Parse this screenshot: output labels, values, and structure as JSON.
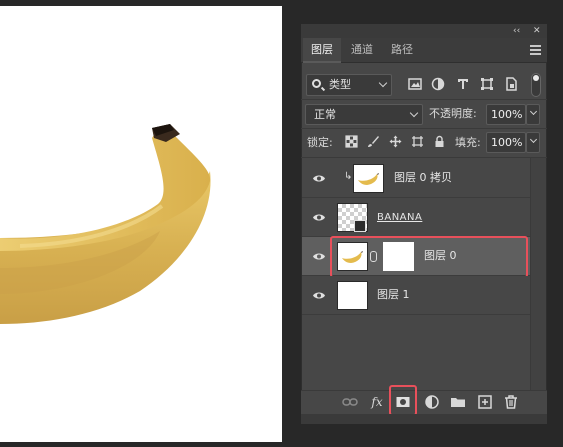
{
  "window": {
    "collapse_icon": "double-chevron-left-icon",
    "close_icon": "close-icon",
    "collapse_glyph": "‹‹",
    "close_glyph": "✕"
  },
  "tabs": [
    {
      "label": "图层",
      "active": true
    },
    {
      "label": "通道",
      "active": false
    },
    {
      "label": "路径",
      "active": false
    }
  ],
  "filter": {
    "kind_label": "类型",
    "icons": [
      "image-filter-icon",
      "adjustment-filter-icon",
      "type-filter-icon",
      "shape-filter-icon",
      "smart-object-filter-icon"
    ]
  },
  "blend": {
    "mode": "正常",
    "opacity_label": "不透明度:",
    "opacity_value": "100%"
  },
  "lock": {
    "label": "锁定:",
    "icons": [
      "lock-transparent-pixels-icon",
      "lock-image-pixels-icon",
      "lock-position-icon",
      "prevent-autonest-icon",
      "lock-all-icon"
    ],
    "fill_label": "填充:",
    "fill_value": "100%"
  },
  "layers": [
    {
      "name": "图层 0 拷贝",
      "visible": true,
      "thumb": "banana",
      "clipped": true,
      "selected": false
    },
    {
      "name": "BANANA",
      "visible": true,
      "thumb": "transparent-smart",
      "clipped": false,
      "selected": false
    },
    {
      "name": "图层 0",
      "visible": true,
      "thumb": "banana",
      "mask": true,
      "selected": true
    },
    {
      "name": "图层 1",
      "visible": true,
      "thumb": "white",
      "selected": false
    }
  ],
  "bottom": {
    "icons": [
      "link-layers-icon",
      "fx-icon",
      "add-mask-icon",
      "adjustment-layer-icon",
      "group-folder-icon",
      "new-layer-icon",
      "trash-icon"
    ],
    "fx_label": "fx"
  },
  "colors": {
    "accent": "#e8505b",
    "panel_bg": "#474747",
    "banana_yellow": "#e6c35a"
  }
}
